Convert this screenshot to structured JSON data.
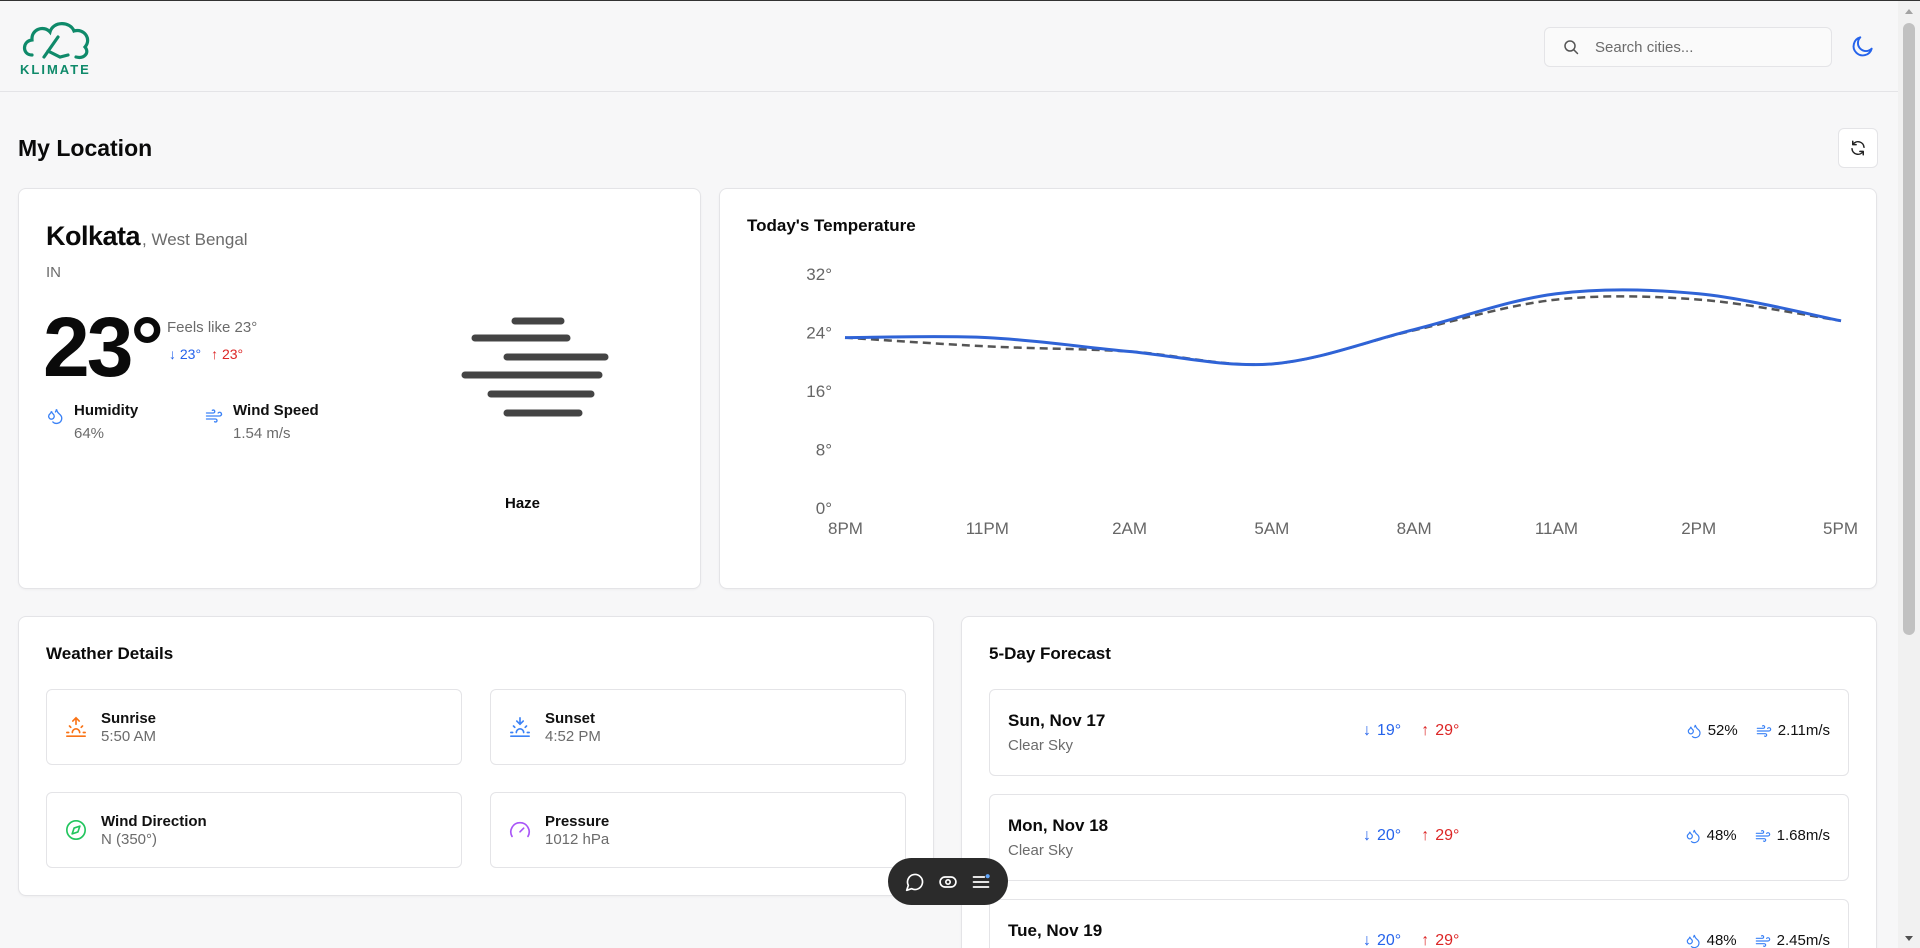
{
  "header": {
    "logo_text": "KLIMATE",
    "search_placeholder": "Search cities...",
    "search_icon": "search-icon",
    "theme_icon": "moon-icon"
  },
  "page": {
    "title": "My Location",
    "refresh_icon": "refresh-icon"
  },
  "current": {
    "city": "Kolkata",
    "region": ", West Bengal",
    "country": "IN",
    "temp": "23°",
    "feels_like": "Feels like 23°",
    "min": "23°",
    "max": "23°",
    "humidity_label": "Humidity",
    "humidity_value": "64%",
    "wind_label": "Wind Speed",
    "wind_value": "1.54 m/s",
    "condition": "Haze"
  },
  "chart_data": {
    "type": "line",
    "title": "Today's Temperature",
    "categories": [
      "8PM",
      "11PM",
      "2AM",
      "5AM",
      "8AM",
      "11AM",
      "2PM",
      "5PM"
    ],
    "yticks": [
      "0°",
      "8°",
      "16°",
      "24°",
      "32°"
    ],
    "ylim": [
      0,
      32
    ],
    "series": [
      {
        "values": [
          23.3,
          23.3,
          21.4,
          19.7,
          24.4,
          29.3,
          29.3,
          25.6
        ],
        "style": "solid",
        "color": "#2f63d6"
      },
      {
        "values": [
          23.3,
          22.1,
          21.4,
          19.7,
          24.3,
          28.5,
          28.5,
          25.6
        ],
        "style": "dashed",
        "color": "#555555"
      }
    ]
  },
  "details": {
    "title": "Weather Details",
    "tiles": [
      {
        "label": "Sunrise",
        "value": "5:50 AM",
        "icon": "sunrise-icon",
        "color": "#f97316"
      },
      {
        "label": "Sunset",
        "value": "4:52 PM",
        "icon": "sunset-icon",
        "color": "#3b82f6"
      },
      {
        "label": "Wind Direction",
        "value": "N (350°)",
        "icon": "compass-icon",
        "color": "#22c55e"
      },
      {
        "label": "Pressure",
        "value": "1012 hPa",
        "icon": "gauge-icon",
        "color": "#a855f7"
      }
    ]
  },
  "forecast": {
    "title": "5-Day Forecast",
    "days": [
      {
        "date": "Sun, Nov 17",
        "desc": "Clear Sky",
        "min": "19°",
        "max": "29°",
        "humidity": "52%",
        "wind": "2.11m/s"
      },
      {
        "date": "Mon, Nov 18",
        "desc": "Clear Sky",
        "min": "20°",
        "max": "29°",
        "humidity": "48%",
        "wind": "1.68m/s"
      },
      {
        "date": "Tue, Nov 19",
        "desc": "",
        "min": "20°",
        "max": "29°",
        "humidity": "48%",
        "wind": "2.45m/s"
      }
    ]
  },
  "toolbar": {
    "icons": [
      "chat-icon",
      "eye-icon",
      "menu-icon"
    ]
  },
  "colors": {
    "accent": "#2563eb",
    "low_temp": "#2563eb",
    "high_temp": "#dc2626",
    "brand": "#0f8a6a"
  }
}
